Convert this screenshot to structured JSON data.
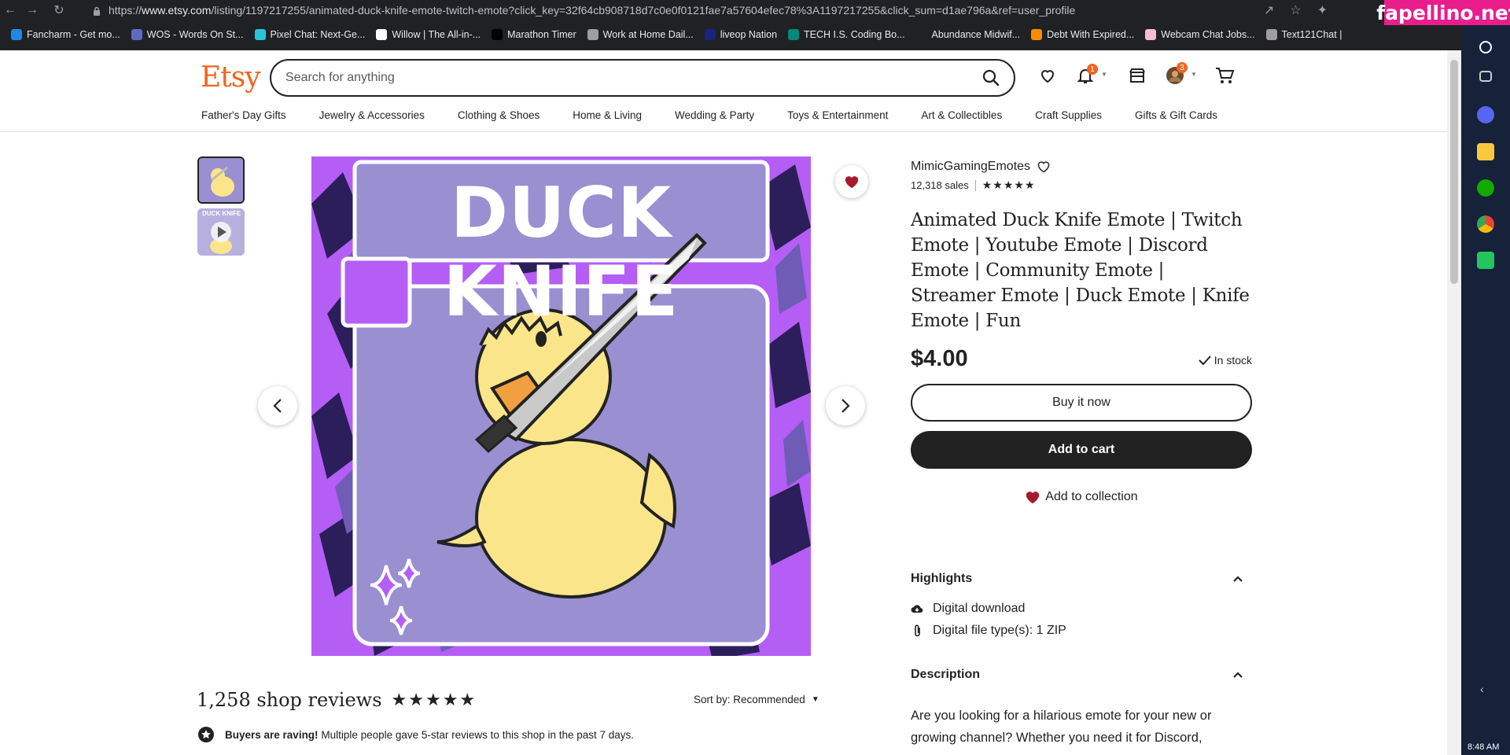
{
  "browser": {
    "url_prefix": "https://",
    "url_host": "www.etsy.com",
    "url_path": "/listing/1197217255/animated-duck-knife-emote-twitch-emote?click_key=32f64cb908718d7c0e0f0121fae7a57604efec78%3A1197217255&click_sum=d1ae796a&ref=user_profile",
    "watermark": "fapellino.net",
    "bookmarks": [
      {
        "label": "Fancharm - Get mo...",
        "color": "#1e88e5"
      },
      {
        "label": "WOS - Words On St...",
        "color": "#5c6bc0"
      },
      {
        "label": "Pixel Chat: Next-Ge...",
        "color": "#26c6da"
      },
      {
        "label": "Willow | The All-in-...",
        "color": "#ffffff"
      },
      {
        "label": "Marathon Timer",
        "color": "#000000"
      },
      {
        "label": "Work at Home Dail...",
        "color": "#9e9e9e"
      },
      {
        "label": "liveop Nation",
        "color": "#1a237e"
      },
      {
        "label": "TECH I.S. Coding Bo...",
        "color": "#00897b"
      },
      {
        "label": "Abundance Midwif...",
        "color": "#202124"
      },
      {
        "label": "Debt With Expired...",
        "color": "#fb8c00"
      },
      {
        "label": "Webcam Chat Jobs...",
        "color": "#f8bbd0"
      },
      {
        "label": "Text121Chat |",
        "color": "#9e9e9e"
      }
    ],
    "time": "8:48 AM"
  },
  "header": {
    "logo": "Etsy",
    "search_placeholder": "Search for anything",
    "notification_count": "1",
    "account_count": "3"
  },
  "categories": [
    "Father's Day Gifts",
    "Jewelry & Accessories",
    "Clothing & Shoes",
    "Home & Living",
    "Wedding & Party",
    "Toys & Entertainment",
    "Art & Collectibles",
    "Craft Supplies",
    "Gifts & Gift Cards"
  ],
  "listing": {
    "image_text": "DUCK KNIFE",
    "thumb_text": "DUCK KNIFE",
    "shop_name": "MimicGamingEmotes",
    "sales": "12,318 sales",
    "rating_stars": 5,
    "title": "Animated Duck Knife Emote | Twitch Emote | Youtube Emote | Discord Emote | Community Emote | Streamer Emote | Duck Emote | Knife Emote | Fun",
    "price": "$4.00",
    "stock": "In stock",
    "buy_now": "Buy it now",
    "add_to_cart": "Add to cart",
    "add_to_collection": "Add to collection"
  },
  "highlights": {
    "heading": "Highlights",
    "items": [
      "Digital download",
      "Digital file type(s): 1 ZIP"
    ]
  },
  "description": {
    "heading": "Description",
    "text": "Are you looking for a hilarious emote for your new or growing channel? Whether you need it for Discord,"
  },
  "reviews": {
    "title": "1,258 shop reviews",
    "sort_label": "Sort by: Recommended",
    "raving_bold": "Buyers are raving!",
    "raving_text": "Multiple people gave 5-star reviews to this shop in the past 7 days."
  },
  "colors": {
    "etsy_orange": "#f1641e",
    "heart_red": "#a61a2e",
    "purple_bg": "#9a8fd0",
    "magenta": "#b45ef5"
  }
}
